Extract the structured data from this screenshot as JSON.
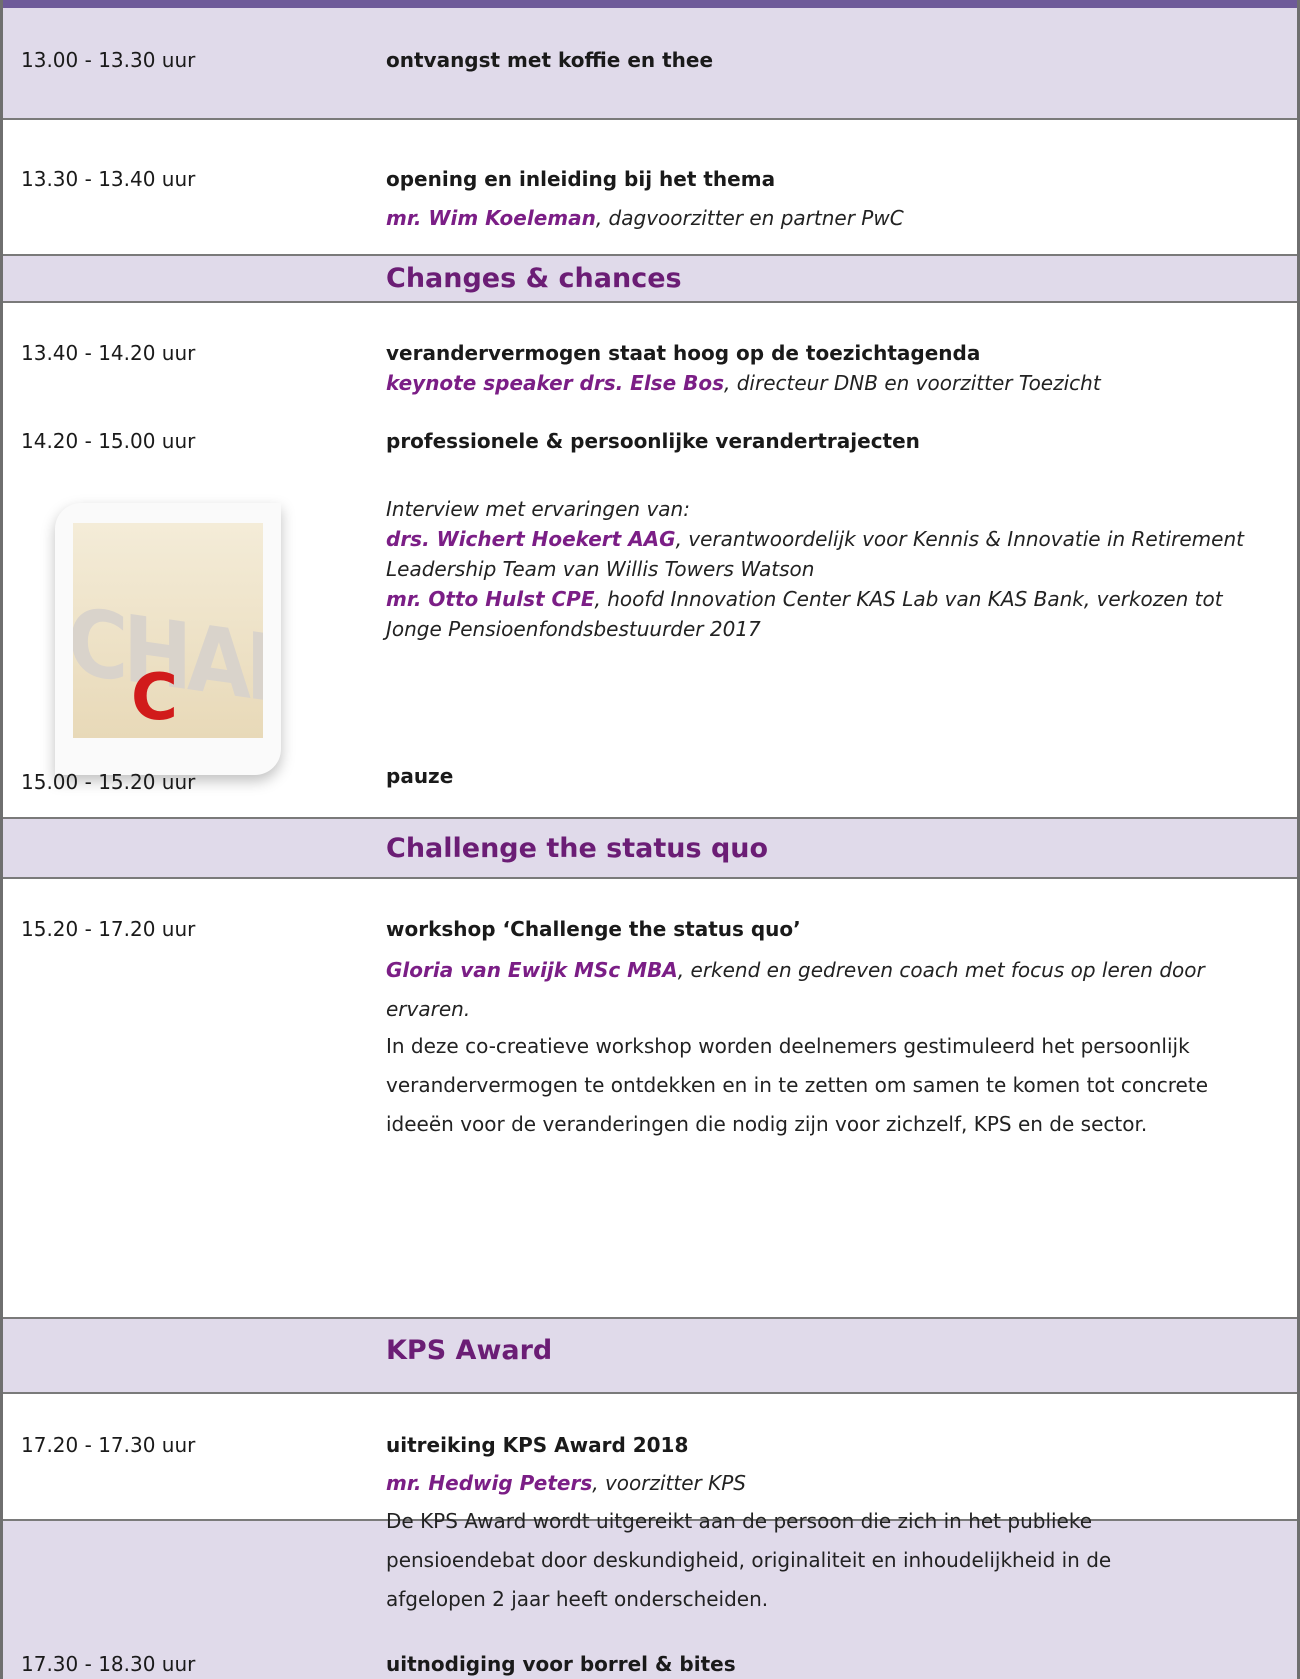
{
  "slots": {
    "s1": {
      "time": "13.00 - 13.30 uur",
      "title": "ontvangst met koffie en thee"
    },
    "s2": {
      "time": "13.30 - 13.40 uur",
      "title": "opening en inleiding bij het thema",
      "speaker_name": "mr. Wim Koeleman",
      "speaker_role": ", dagvoorzitter en partner PwC"
    },
    "s3": {
      "time": "13.40 - 14.20 uur",
      "title": "verandervermogen staat hoog op de toezichtagenda",
      "speaker_name": "keynote speaker drs. Else Bos",
      "speaker_role": ", directeur DNB en voorzitter Toezicht"
    },
    "s4": {
      "time": "14.20 - 15.00 uur",
      "title": "professionele & persoonlijke verandertrajecten",
      "intro": "Interview met ervaringen van:",
      "speaker1_name": "drs. Wichert Hoekert AAG",
      "speaker1_role_a": ", verantwoordelijk voor Kennis & Innovatie in Retirement",
      "speaker1_role_b": "Leadership Team van Willis Towers Watson",
      "speaker2_name": "mr. Otto Hulst CPE",
      "speaker2_role_a": ", hoofd Innovation Center KAS Lab van KAS Bank, verkozen tot",
      "speaker2_role_b": "Jonge Pensioenfondsbestuurder 2017"
    },
    "s5": {
      "time": "15.00 - 15.20 uur",
      "title": "pauze"
    },
    "s6": {
      "time": "15.20 - 17.20 uur",
      "title": "workshop ‘Challenge the status quo’",
      "speaker_name": "Gloria van Ewijk MSc MBA",
      "speaker_role_a": ", erkend en gedreven coach met focus op leren door",
      "speaker_role_b": "ervaren.",
      "desc_1": "In deze co-creatieve workshop worden deelnemers gestimuleerd het persoonlijk",
      "desc_2": "verandervermogen te ontdekken en in te zetten om samen te komen tot concrete",
      "desc_3": "ideeën voor de veranderingen die nodig zijn voor zichzelf, KPS en de sector."
    },
    "s7": {
      "time": "17.20 - 17.30 uur",
      "title": "uitreiking KPS Award 2018",
      "speaker_name": "mr. Hedwig Peters",
      "speaker_role": ", voorzitter KPS",
      "desc_1": "De KPS Award wordt uitgereikt aan de persoon die zich in het publieke",
      "desc_2": "pensioendebat door deskundigheid, originaliteit en inhoudelijkheid in de",
      "desc_3": "afgelopen 2 jaar heeft onderscheiden."
    },
    "s8": {
      "time": "17.30 - 18.30 uur",
      "title": "uitnodiging voor borrel & bites"
    }
  },
  "sections": {
    "changes": "Changes & chances",
    "challenge": "Challenge the status quo",
    "award": "KPS Award"
  },
  "image": {
    "word": "CHANGE",
    "letter": "C"
  },
  "colors": {
    "accent": "#6b1d75",
    "speaker": "#7b1e86",
    "band": "#e0daea",
    "topbar": "#6e5a99"
  }
}
